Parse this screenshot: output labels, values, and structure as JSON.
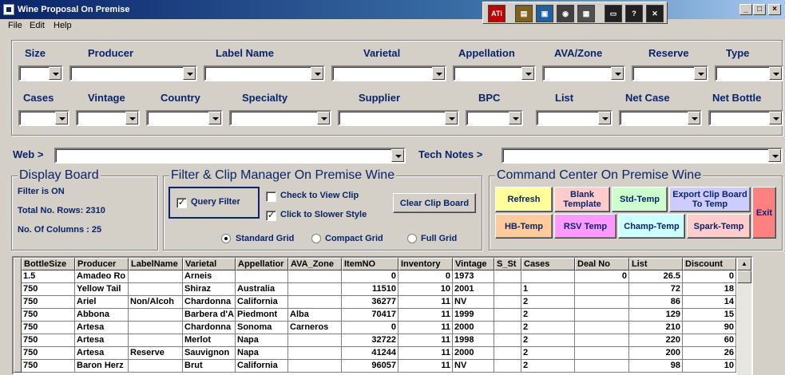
{
  "window": {
    "title": "Wine Proposal On Premise"
  },
  "tray_icons": [
    "ati-icon",
    "notepad-icon",
    "printer-icon",
    "media-icon",
    "display-icon"
  ],
  "tray_buttons": [
    "monitor-icon",
    "help-icon",
    "close-icon"
  ],
  "menu": [
    "File",
    "Edit",
    "Help"
  ],
  "filters_row1": [
    "Size",
    "Producer",
    "Label Name",
    "Varietal",
    "Appellation",
    "AVA/Zone",
    "Reserve",
    "Type"
  ],
  "filters_row2": [
    "Cases",
    "Vintage",
    "Country",
    "Specialty",
    "Supplier",
    "BPC",
    "List",
    "Net Case",
    "Net Bottle"
  ],
  "web_label": "Web >",
  "tech_notes_label": "Tech Notes >",
  "display_board": {
    "title": "Display Board",
    "filter_status": "Filter is ON",
    "total_rows": "Total No. Rows: 2310",
    "columns": "No. Of Columns : 25"
  },
  "filter_clip": {
    "title": "Filter & Clip Manager On Premise Wine",
    "query_filter": "Query  Filter",
    "check_view_clip": "Check to View Clip",
    "click_slower": "Click to Slower  Style",
    "clear_clip": "Clear Clip Board",
    "standard_grid": "Standard Grid",
    "compact_grid": "Compact Grid",
    "full_grid": "Full Grid"
  },
  "command_center": {
    "title": "Command Center On Premise Wine",
    "buttons": [
      {
        "label": "Refresh",
        "color": "#ffff99"
      },
      {
        "label": "Blank Template",
        "color": "#ffcccc"
      },
      {
        "label": "Std-Temp",
        "color": "#ccffcc"
      },
      {
        "label": "Export Clip Board To Temp",
        "color": "#ccccff"
      },
      {
        "label": "HB-Temp",
        "color": "#ffcc99"
      },
      {
        "label": "RSV Temp",
        "color": "#ff99ff"
      },
      {
        "label": "Champ-Temp",
        "color": "#ccffff"
      },
      {
        "label": "Spark-Temp",
        "color": "#ffcccc"
      }
    ],
    "exit": {
      "label": "Exit",
      "color": "#ff8080"
    }
  },
  "grid": {
    "columns": [
      "BottleSize",
      "Producer",
      "LabelName",
      "Varietal",
      "Appellatior",
      "AVA_Zone",
      "ItemNO",
      "Inventory",
      "Vintage",
      "S_St",
      "Cases",
      "Deal No",
      "List",
      "Discount"
    ],
    "rows": [
      [
        "1.5",
        "Amadeo Ro",
        "",
        "Arneis",
        "",
        "",
        "0",
        "0",
        "1973",
        "",
        "",
        "0",
        "26.5",
        "0"
      ],
      [
        "750",
        "Yellow Tail",
        "",
        "Shiraz",
        "Australia",
        "",
        "11510",
        "10",
        "2001",
        "",
        "1",
        "",
        "72",
        "18"
      ],
      [
        "750",
        "Ariel",
        "Non/Alcoh",
        "Chardonna",
        "California",
        "",
        "36277",
        "11",
        "NV",
        "",
        "2",
        "",
        "86",
        "14"
      ],
      [
        "750",
        "Abbona",
        "",
        "Barbera d'A",
        "Piedmont",
        "Alba",
        "70417",
        "11",
        "1999",
        "",
        "2",
        "",
        "129",
        "15"
      ],
      [
        "750",
        "Artesa",
        "",
        "Chardonna",
        "Sonoma",
        "Carneros",
        "0",
        "11",
        "2000",
        "",
        "2",
        "",
        "210",
        "90"
      ],
      [
        "750",
        "Artesa",
        "",
        "Merlot",
        "Napa",
        "",
        "32722",
        "11",
        "1998",
        "",
        "2",
        "",
        "220",
        "60"
      ],
      [
        "750",
        "Artesa",
        "Reserve",
        "Sauvignon",
        "Napa",
        "",
        "41244",
        "11",
        "2000",
        "",
        "2",
        "",
        "200",
        "26"
      ],
      [
        "750",
        "Baron Herz",
        "",
        "Brut",
        "California",
        "",
        "96057",
        "11",
        "NV",
        "",
        "2",
        "",
        "98",
        "10"
      ]
    ]
  }
}
